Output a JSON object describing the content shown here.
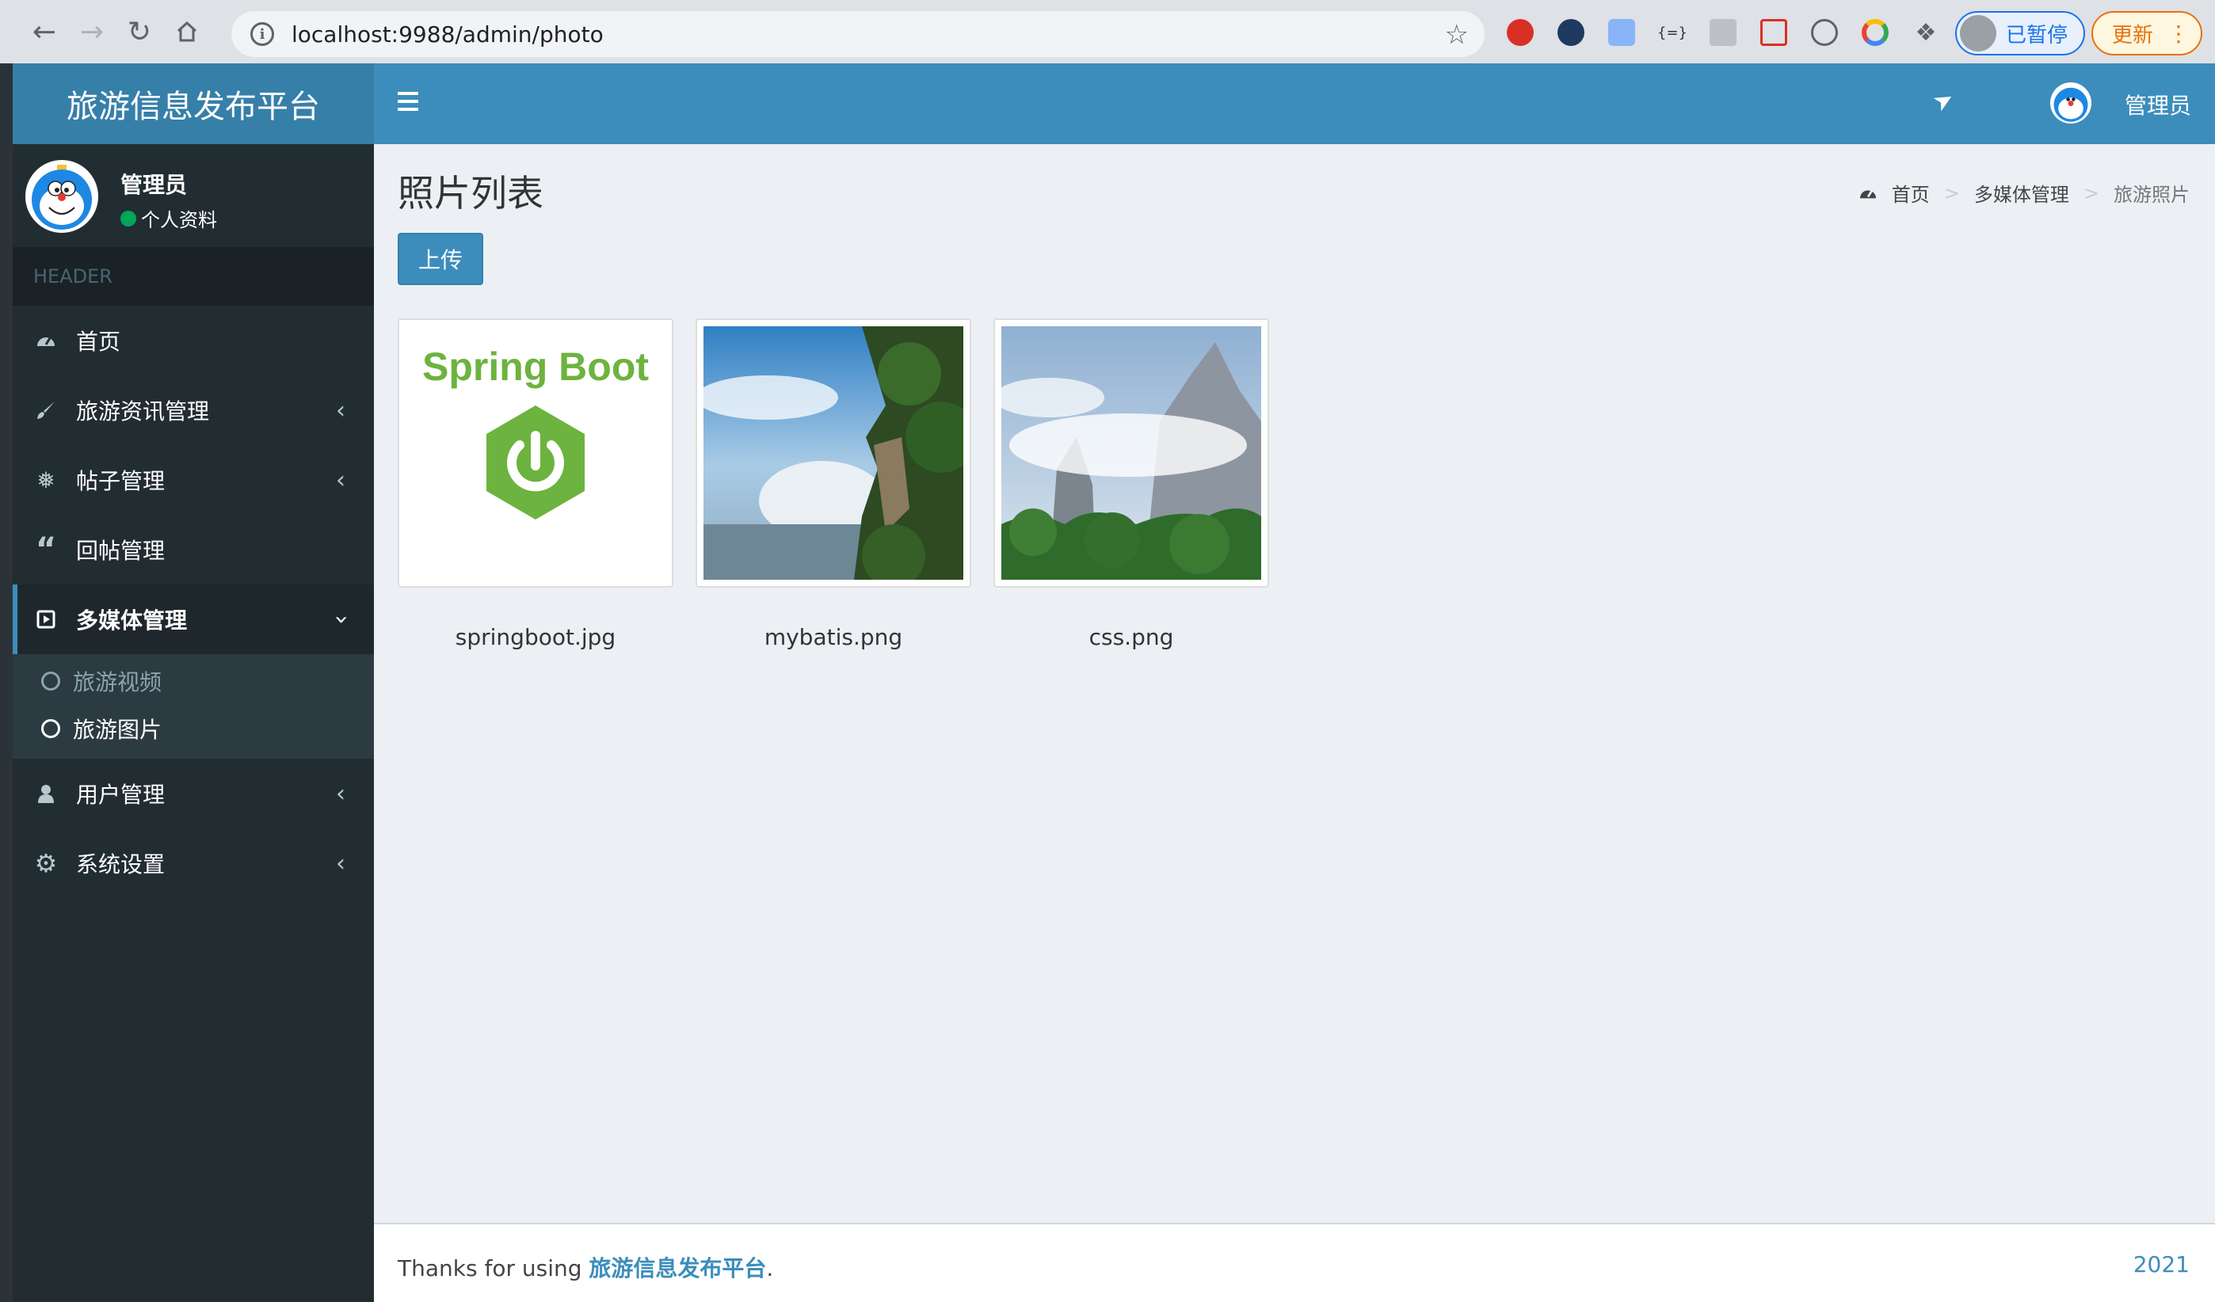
{
  "browser": {
    "url": "localhost:9988/admin/photo",
    "paused_label": "已暂停",
    "update_label": "更新"
  },
  "sidebar": {
    "logo": "旅游信息发布平台",
    "user_name": "管理员",
    "user_link": "个人资料",
    "header": "HEADER",
    "items": [
      {
        "label": "首页",
        "icon": "dashboard-icon"
      },
      {
        "label": "旅游资讯管理",
        "icon": "brush-icon"
      },
      {
        "label": "帖子管理",
        "icon": "snowflake-icon"
      },
      {
        "label": "回帖管理",
        "icon": "quote-icon"
      },
      {
        "label": "多媒体管理",
        "icon": "play-square-icon"
      },
      {
        "label": "用户管理",
        "icon": "user-icon"
      },
      {
        "label": "系统设置",
        "icon": "gear-icon"
      }
    ],
    "submenu": [
      {
        "label": "旅游视频"
      },
      {
        "label": "旅游图片"
      }
    ]
  },
  "navbar": {
    "user_name": "管理员"
  },
  "content": {
    "title": "照片列表",
    "upload_label": "上传",
    "breadcrumb": [
      "首页",
      "多媒体管理",
      "旅游照片"
    ],
    "photos": [
      {
        "caption": "springboot.jpg",
        "image_text": "Spring Boot"
      },
      {
        "caption": "mybatis.png"
      },
      {
        "caption": "css.png"
      }
    ]
  },
  "footer": {
    "prefix": "Thanks for using ",
    "link": "旅游信息发布平台",
    "suffix": ".",
    "year": "2021"
  },
  "colors": {
    "primary": "#3c8dbc",
    "sidebar_bg": "#222d32",
    "content_bg": "#ecf0f5"
  }
}
